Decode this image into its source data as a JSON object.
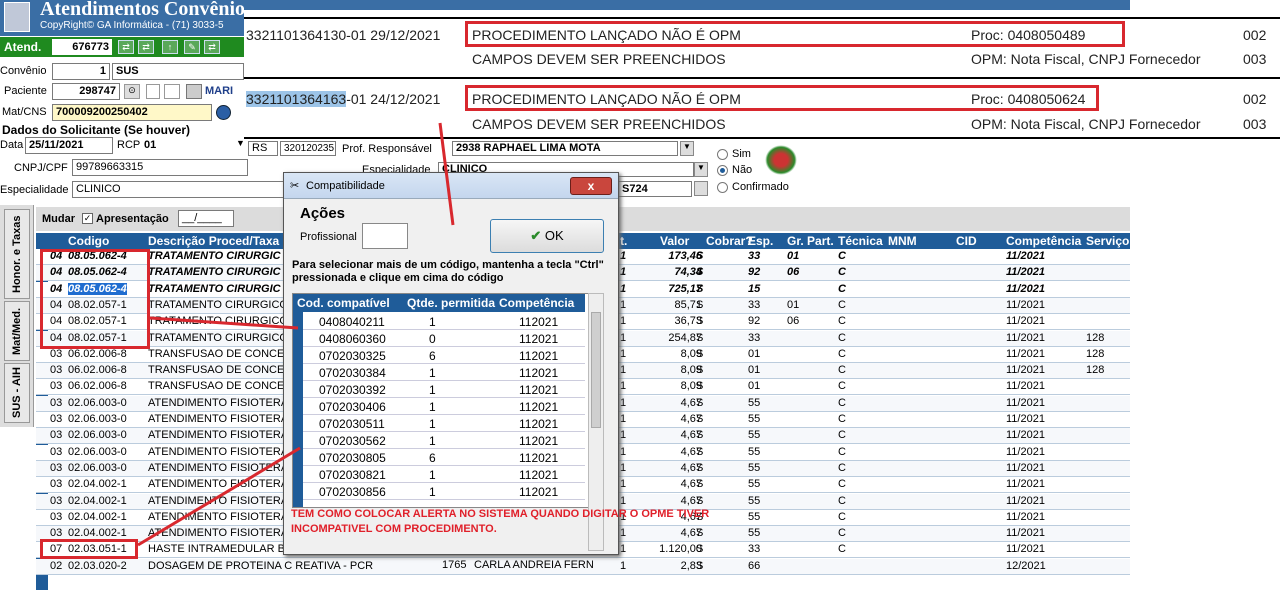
{
  "header": {
    "title": "Atendimentos Convênios",
    "copyright": "CopyRight© GA Informática - (71) 3033-5"
  },
  "atend": {
    "label": "Atend.",
    "value": "676773"
  },
  "form": {
    "convenio_label": "Convênio",
    "convenio_num": "1",
    "convenio_name": "SUS",
    "paciente_label": "Paciente",
    "paciente_num": "298747",
    "paciente_name": "MARI",
    "matcns_label": "Mat/CNS",
    "matcns_value": "700009200250402",
    "solicitante_title": "Dados do Solicitante (Se houver)",
    "data_label": "Data",
    "data_value": "25/11/2021",
    "rcp_label": "RCP",
    "rcp_value": "01",
    "cnpj_label": "CNPJ/CPF",
    "cnpj_value": "99789663315",
    "especialidade_label": "Especialidade",
    "especialidade_value": "CLINICO",
    "prof_resp_label": "Prof. Responsável",
    "prof_resp_value": "2938 RAPHAEL LIMA MOTA",
    "rs_value": "RS",
    "num_value": "320120235",
    "esp2_label": "Especialidade",
    "esp2_value": "CLINICO",
    "sim": "Sim",
    "nao": "Não",
    "confirmado": "Confirmado",
    "s724": "S724"
  },
  "banner": {
    "row1": {
      "id": "3321101364130-01 29/12/2021",
      "msg": "PROCEDIMENTO LANÇADO NÃO É OPM",
      "proc": "Proc: 0408050489",
      "code": "002"
    },
    "row1b": {
      "msg": "CAMPOS DEVEM SER PREENCHIDOS",
      "opm": "OPM: Nota Fiscal, CNPJ Fornecedor",
      "code": "003"
    },
    "row2": {
      "id_hl": "3321101364163",
      "id_rest": "-01 24/12/2021",
      "msg": "PROCEDIMENTO LANÇADO NÃO É OPM",
      "proc": "Proc: 0408050624",
      "code": "002"
    },
    "row2b": {
      "msg": "CAMPOS DEVEM SER PREENCHIDOS",
      "opm": "OPM: Nota Fiscal, CNPJ Fornecedor",
      "code": "003"
    }
  },
  "tabs": [
    "Honor. e Taxas",
    "Mat/Med.",
    "SUS - AIH"
  ],
  "grid": {
    "mudar": "Mudar",
    "apresentacao": "Apresentação",
    "apres_value": "__/____",
    "headers": {
      "codigo": "Codigo",
      "descricao": "Descrição Proced/Taxa",
      "qt": "t.",
      "valor": "Valor",
      "cobrar": "Cobrar?",
      "esp": "Esp.",
      "grpart": "Gr. Part.",
      "tecnica": "Técnica",
      "mnm": "MNM",
      "cid": "CID",
      "competencia": "Competência",
      "servico": "Serviço"
    },
    "rows": [
      {
        "g": "04",
        "cod": "08.05.062-4",
        "desc": "TRATAMENTO CIRURGIC",
        "qt": "1",
        "valor": "173,46",
        "cob": "S",
        "esp": "33",
        "gp": "01",
        "tec": "C",
        "comp": "11/2021",
        "serv": "",
        "style": "bi"
      },
      {
        "g": "04",
        "cod": "08.05.062-4",
        "desc": "TRATAMENTO CIRURGIC",
        "qt": "1",
        "valor": "74,34",
        "cob": "S",
        "esp": "92",
        "gp": "06",
        "tec": "C",
        "comp": "11/2021",
        "serv": "",
        "style": "bi"
      },
      {
        "g": "04",
        "cod": "08.05.062-4",
        "desc": "TRATAMENTO CIRURGIC",
        "qt": "1",
        "valor": "725,17",
        "cob": "S",
        "esp": "15",
        "gp": "",
        "tec": "C",
        "comp": "11/2021",
        "serv": "",
        "style": "bi sel"
      },
      {
        "g": "04",
        "cod": "08.02.057-1",
        "desc": "TRATAMENTO CIRURGICO",
        "qt": "1",
        "valor": "85,71",
        "cob": "S",
        "esp": "33",
        "gp": "01",
        "tec": "C",
        "comp": "11/2021",
        "serv": "",
        "style": ""
      },
      {
        "g": "04",
        "cod": "08.02.057-1",
        "desc": "TRATAMENTO CIRURGICO",
        "qt": "1",
        "valor": "36,73",
        "cob": "S",
        "esp": "92",
        "gp": "06",
        "tec": "C",
        "comp": "11/2021",
        "serv": "",
        "style": ""
      },
      {
        "g": "04",
        "cod": "08.02.057-1",
        "desc": "TRATAMENTO CIRURGICO",
        "qt": "1",
        "valor": "254,87",
        "cob": "S",
        "esp": "33",
        "gp": "",
        "tec": "C",
        "comp": "11/2021",
        "serv": "128",
        "style": ""
      },
      {
        "g": "03",
        "cod": "06.02.006-8",
        "desc": "TRANSFUSAO DE CONCE",
        "qt": "1",
        "valor": "8,09",
        "cob": "S",
        "esp": "01",
        "gp": "",
        "tec": "C",
        "comp": "11/2021",
        "serv": "128",
        "style": ""
      },
      {
        "g": "03",
        "cod": "06.02.006-8",
        "desc": "TRANSFUSAO DE CONCE",
        "qt": "1",
        "valor": "8,09",
        "cob": "S",
        "esp": "01",
        "gp": "",
        "tec": "C",
        "comp": "11/2021",
        "serv": "128",
        "style": ""
      },
      {
        "g": "03",
        "cod": "06.02.006-8",
        "desc": "TRANSFUSAO DE CONCE",
        "qt": "1",
        "valor": "8,09",
        "cob": "S",
        "esp": "01",
        "gp": "",
        "tec": "C",
        "comp": "11/2021",
        "serv": "",
        "style": ""
      },
      {
        "g": "03",
        "cod": "02.06.003-0",
        "desc": "ATENDIMENTO FISIOTERA",
        "qt": "1",
        "valor": "4,67",
        "cob": "S",
        "esp": "55",
        "gp": "",
        "tec": "C",
        "comp": "11/2021",
        "serv": "",
        "style": ""
      },
      {
        "g": "03",
        "cod": "02.06.003-0",
        "desc": "ATENDIMENTO FISIOTERA",
        "qt": "1",
        "valor": "4,67",
        "cob": "S",
        "esp": "55",
        "gp": "",
        "tec": "C",
        "comp": "11/2021",
        "serv": "",
        "style": ""
      },
      {
        "g": "03",
        "cod": "02.06.003-0",
        "desc": "ATENDIMENTO FISIOTERA",
        "qt": "1",
        "valor": "4,67",
        "cob": "S",
        "esp": "55",
        "gp": "",
        "tec": "C",
        "comp": "11/2021",
        "serv": "",
        "style": ""
      },
      {
        "g": "03",
        "cod": "02.06.003-0",
        "desc": "ATENDIMENTO FISIOTERA",
        "qt": "1",
        "valor": "4,67",
        "cob": "S",
        "esp": "55",
        "gp": "",
        "tec": "C",
        "comp": "11/2021",
        "serv": "",
        "style": ""
      },
      {
        "g": "03",
        "cod": "02.06.003-0",
        "desc": "ATENDIMENTO FISIOTERA",
        "qt": "1",
        "valor": "4,67",
        "cob": "S",
        "esp": "55",
        "gp": "",
        "tec": "C",
        "comp": "11/2021",
        "serv": "",
        "style": ""
      },
      {
        "g": "03",
        "cod": "02.04.002-1",
        "desc": "ATENDIMENTO FISIOTERA",
        "qt": "1",
        "valor": "4,67",
        "cob": "S",
        "esp": "55",
        "gp": "",
        "tec": "C",
        "comp": "11/2021",
        "serv": "",
        "style": ""
      },
      {
        "g": "03",
        "cod": "02.04.002-1",
        "desc": "ATENDIMENTO FISIOTERA",
        "qt": "1",
        "valor": "4,67",
        "cob": "S",
        "esp": "55",
        "gp": "",
        "tec": "C",
        "comp": "11/2021",
        "serv": "",
        "style": ""
      },
      {
        "g": "03",
        "cod": "02.04.002-1",
        "desc": "ATENDIMENTO FISIOTERA",
        "qt": "1",
        "valor": "4,67",
        "cob": "S",
        "esp": "55",
        "gp": "",
        "tec": "C",
        "comp": "11/2021",
        "serv": "",
        "style": ""
      },
      {
        "g": "03",
        "cod": "02.04.002-1",
        "desc": "ATENDIMENTO FISIOTERA",
        "qt": "1",
        "valor": "4,67",
        "cob": "S",
        "esp": "55",
        "gp": "",
        "tec": "C",
        "comp": "11/2021",
        "serv": "",
        "style": ""
      },
      {
        "g": "07",
        "cod": "02.03.051-1",
        "desc": "HASTE INTRAMEDULAR B",
        "qt": "1",
        "valor": "1.120,00",
        "cob": "S",
        "esp": "33",
        "gp": "",
        "tec": "C",
        "comp": "11/2021",
        "serv": "",
        "style": ""
      },
      {
        "g": "02",
        "cod": "02.03.020-2",
        "desc": "DOSAGEM DE PROTEINA C REATIVA - PCR",
        "qt": "1",
        "valor": "2,83",
        "cob": "S",
        "esp": "66",
        "gp": "",
        "tec": "",
        "comp": "12/2021",
        "serv": "",
        "style": ""
      }
    ],
    "last_row_extra": {
      "num": "1765",
      "name": "CARLA ANDREIA FERN"
    }
  },
  "dialog": {
    "title": "Compatibilidade",
    "close": "x",
    "acoes": "Ações",
    "profissional": "Profissional",
    "ok": "OK",
    "hint": "Para selecionar mais de um código, mantenha a tecla \"Ctrl\" pressionada e clique em cima do código",
    "headers": {
      "cod": "Cod. compatível",
      "qtde": "Qtde. permitida",
      "comp": "Competência"
    },
    "rows": [
      {
        "cod": "0408040211",
        "qtde": "1",
        "comp": "112021"
      },
      {
        "cod": "0408060360",
        "qtde": "0",
        "comp": "112021"
      },
      {
        "cod": "0702030325",
        "qtde": "6",
        "comp": "112021"
      },
      {
        "cod": "0702030384",
        "qtde": "1",
        "comp": "112021"
      },
      {
        "cod": "0702030392",
        "qtde": "1",
        "comp": "112021"
      },
      {
        "cod": "0702030406",
        "qtde": "1",
        "comp": "112021"
      },
      {
        "cod": "0702030511",
        "qtde": "1",
        "comp": "112021"
      },
      {
        "cod": "0702030562",
        "qtde": "1",
        "comp": "112021"
      },
      {
        "cod": "0702030805",
        "qtde": "6",
        "comp": "112021"
      },
      {
        "cod": "0702030821",
        "qtde": "1",
        "comp": "112021"
      },
      {
        "cod": "0702030856",
        "qtde": "1",
        "comp": "112021"
      }
    ]
  },
  "annotation": {
    "line1": "TEM COMO COLOCAR ALERTA NO SISTEMA QUANDO DIGITAR O OPME TIVER",
    "line2": "INCOMPATIVEL COM PROCEDIMENTO."
  },
  "colors": {
    "accent_red": "#d8282e",
    "header_blue": "#1f5c99",
    "title_blue": "#3a6ea5",
    "green": "#1f8a1f"
  }
}
